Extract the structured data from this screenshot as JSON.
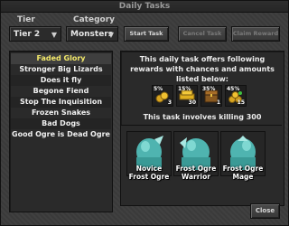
{
  "window": {
    "title": "Daily Tasks"
  },
  "filters": {
    "tier_label": "Tier",
    "tier_value": "Tier 2",
    "category_label": "Category",
    "category_value": "Monsters"
  },
  "buttons": {
    "start": "Start Task",
    "cancel": "Cancel Task",
    "claim": "Claim Reward",
    "close": "Close"
  },
  "tasks": [
    {
      "label": "Faded Glory",
      "selected": true
    },
    {
      "label": "Stronger Big Lizards"
    },
    {
      "label": "Does it fly"
    },
    {
      "label": "Begone Fiend"
    },
    {
      "label": "Stop The Inquisition"
    },
    {
      "label": "Frozen Snakes"
    },
    {
      "label": "Bad Dogs"
    },
    {
      "label": "Good Ogre is Dead Ogre"
    }
  ],
  "details": {
    "line1": "This daily task offers following",
    "line2": "rewards with chances and amounts",
    "line3": "listed below:",
    "rewards": [
      {
        "pct": "5%",
        "amount": "3",
        "icon": "gold-coins-icon"
      },
      {
        "pct": "15%",
        "amount": "30",
        "icon": "gold-ingot-icon"
      },
      {
        "pct": "35%",
        "amount": "1",
        "icon": "chest-icon"
      },
      {
        "pct": "45%",
        "amount": "15",
        "icon": "gold-coins-pile-icon"
      }
    ],
    "kill_text": "This task involves killing 300"
  },
  "monsters": [
    {
      "line1": "Novice",
      "line2": "Frost Ogre"
    },
    {
      "line1": "Frost Ogre",
      "line2": "Warrior"
    },
    {
      "line1": "Frost Ogre",
      "line2": "Mage"
    }
  ],
  "colors": {
    "selected_task": "#f3e96a",
    "window_bg": "#3b3b3b",
    "panel_bg": "#2a2a2a"
  }
}
